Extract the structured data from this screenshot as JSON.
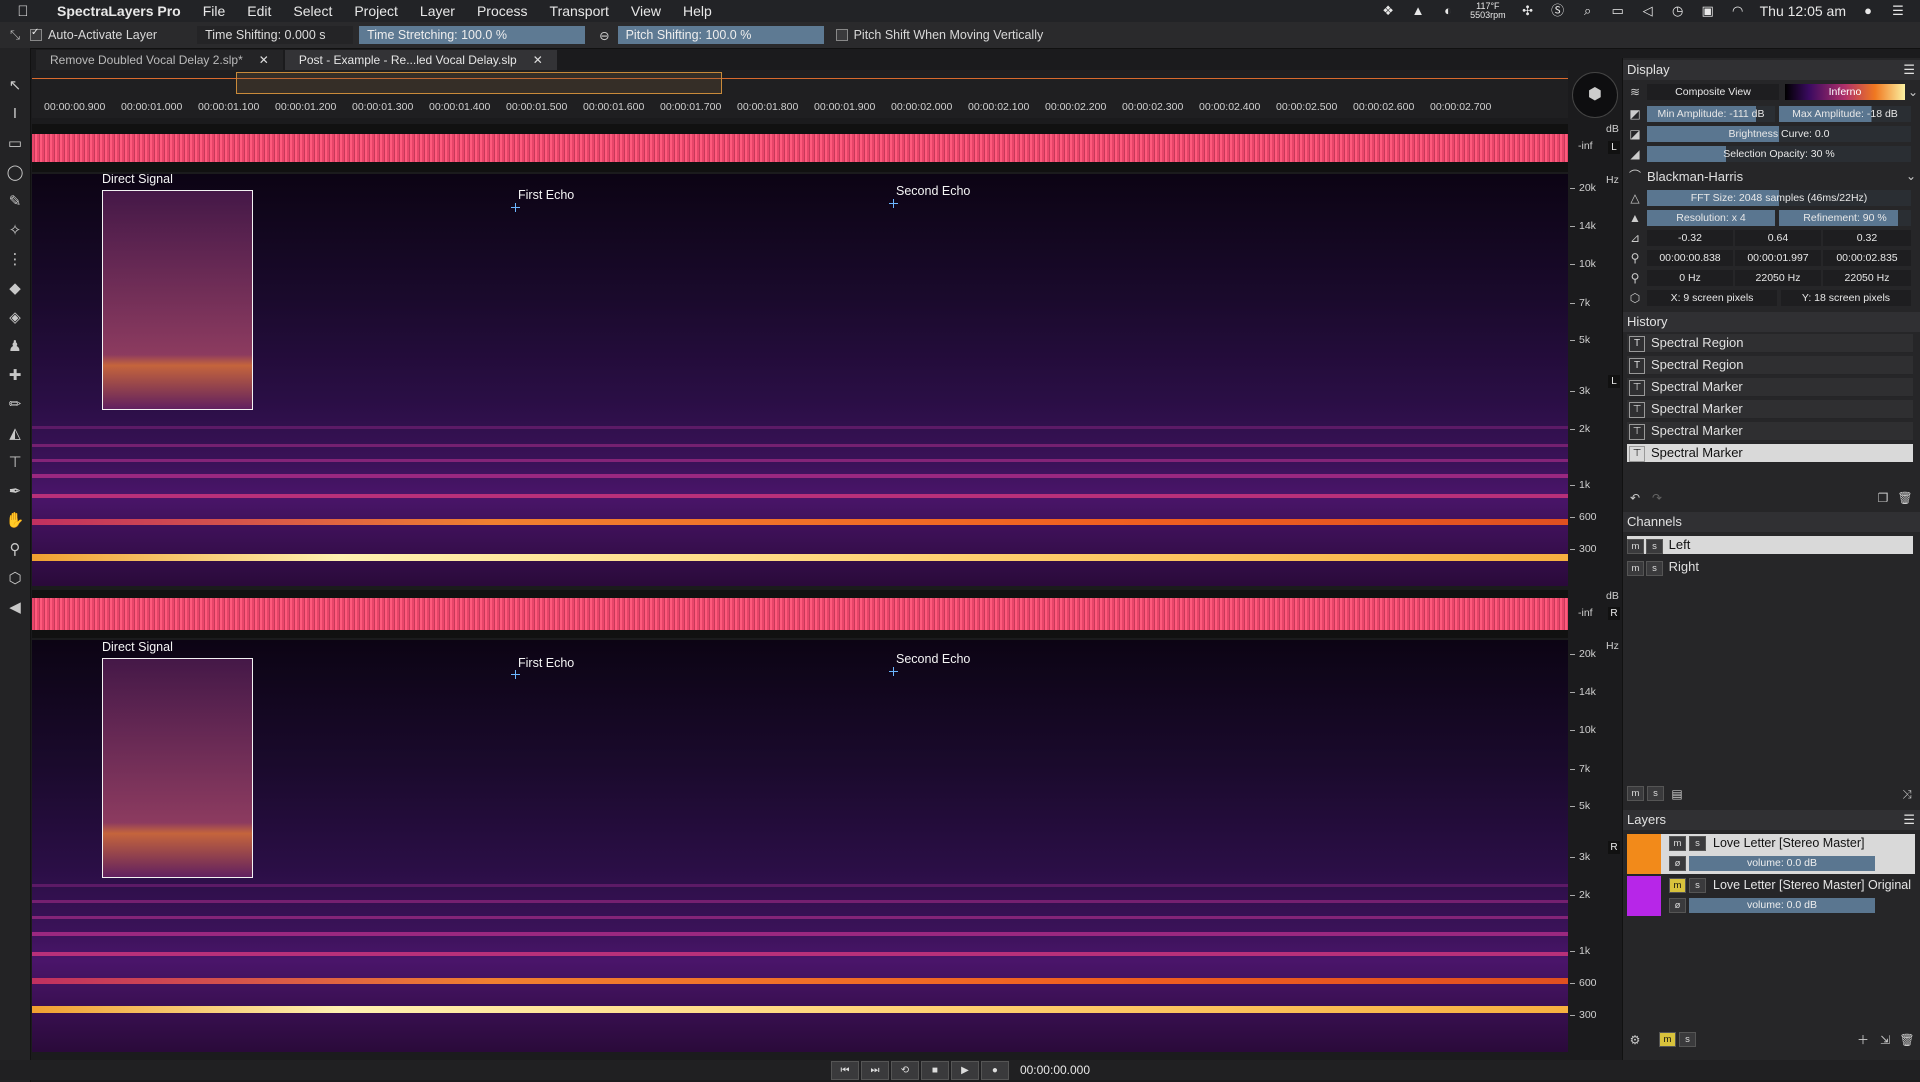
{
  "menubar": {
    "app": "SpectraLayers Pro",
    "menus": [
      "File",
      "Edit",
      "Select",
      "Project",
      "Layer",
      "Process",
      "Transport",
      "View",
      "Help"
    ],
    "temp_line1": "117°F",
    "temp_line2": "5503rpm",
    "clock": "Thu 12:05 am"
  },
  "options": {
    "auto_activate_label": "Auto-Activate Layer",
    "time_shifting": "Time Shifting: 0.000 s",
    "time_stretching": "Time Stretching: 100.0 %",
    "pitch_shifting": "Pitch Shifting: 100.0 %",
    "pitch_vertical": "Pitch Shift When Moving Vertically"
  },
  "tabs": [
    {
      "label": "Remove Doubled Vocal Delay 2.slp*",
      "active": false
    },
    {
      "label": "Post - Example - Re...led Vocal Delay.slp",
      "active": true
    }
  ],
  "ruler": [
    "00:00:00.900",
    "00:00:01.000",
    "00:00:01.100",
    "00:00:01.200",
    "00:00:01.300",
    "00:00:01.400",
    "00:00:01.500",
    "00:00:01.600",
    "00:00:01.700",
    "00:00:01.800",
    "00:00:01.900",
    "00:00:02.000",
    "00:00:02.100",
    "00:00:02.200",
    "00:00:02.300",
    "00:00:02.400",
    "00:00:02.500",
    "00:00:02.600",
    "00:00:02.700"
  ],
  "annotations": {
    "direct": "Direct Signal",
    "first": "First Echo",
    "second": "Second Echo"
  },
  "wave_axis": {
    "unit": "dB",
    "inf": "-inf",
    "left": "L",
    "right": "R"
  },
  "freq_axis": {
    "unit": "Hz",
    "labels": [
      "20k",
      "14k",
      "10k",
      "7k",
      "5k",
      "3k",
      "2k",
      "1k",
      "600",
      "300"
    ]
  },
  "display": {
    "title": "Display",
    "view": "Composite View",
    "colormap": "Inferno",
    "min_amp": "Min Amplitude: -111 dB",
    "max_amp": "Max Amplitude: -18 dB",
    "brightness": "Brightness Curve: 0.0",
    "sel_opacity": "Selection Opacity: 30 %",
    "window": "Blackman-Harris",
    "fft": "FFT Size: 2048 samples (46ms/22Hz)",
    "resolution": "Resolution: x 4",
    "refinement": "Refinement: 90 %",
    "vals1": [
      "-0.32",
      "0.64",
      "0.32"
    ],
    "vals2": [
      "00:00:00.838",
      "00:00:01.997",
      "00:00:02.835"
    ],
    "vals3": [
      "0  Hz",
      "22050  Hz",
      "22050  Hz"
    ],
    "px_x": "X: 9  screen pixels",
    "px_y": "Y: 18 screen pixels"
  },
  "history": {
    "title": "History",
    "items": [
      "Spectral Region",
      "Spectral Region",
      "Spectral Marker",
      "Spectral Marker",
      "Spectral Marker",
      "Spectral Marker"
    ]
  },
  "channels": {
    "title": "Channels",
    "items": [
      "Left",
      "Right"
    ]
  },
  "layers": {
    "title": "Layers",
    "items": [
      {
        "name": "Love Letter [Stereo Master]",
        "volume": "volume: 0.0 dB",
        "color": "#f28a1a"
      },
      {
        "name": "Love Letter [Stereo Master] Original",
        "volume": "volume: 0.0 dB",
        "color": "#b726e8"
      }
    ]
  },
  "transport": {
    "time": "00:00:00.000"
  }
}
